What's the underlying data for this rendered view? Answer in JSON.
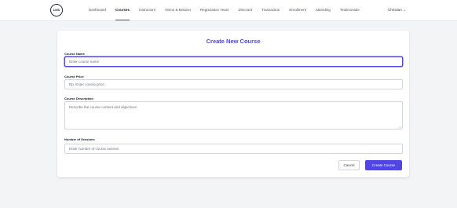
{
  "brand": {
    "logo_text": "LMS"
  },
  "nav": {
    "links": [
      {
        "label": "Dashboard"
      },
      {
        "label": "Courses"
      },
      {
        "label": "Instructors"
      },
      {
        "label": "Vision & Mission"
      },
      {
        "label": "Registration Years"
      },
      {
        "label": "Discount"
      },
      {
        "label": "Transaction"
      },
      {
        "label": "Enrollment"
      },
      {
        "label": "Attending"
      },
      {
        "label": "Testimonials"
      }
    ],
    "active": "Courses",
    "user": "Christian"
  },
  "form": {
    "title": "Create New Course",
    "course_name": {
      "label": "Course Name",
      "placeholder": "Enter course name",
      "value": ""
    },
    "course_price": {
      "label": "Course Price",
      "placeholder": "Rp  Enter course price",
      "value": ""
    },
    "course_description": {
      "label": "Course Description",
      "placeholder": "Describe the course content and objectives",
      "value": ""
    },
    "sessions": {
      "label": "Number of Sessions",
      "placeholder": "Enter number of course session",
      "value": ""
    },
    "cancel_label": "Cancel",
    "submit_label": "Create Course"
  },
  "colors": {
    "accent": "#4f46e5",
    "background": "#f3f4f6",
    "card": "#ffffff"
  }
}
